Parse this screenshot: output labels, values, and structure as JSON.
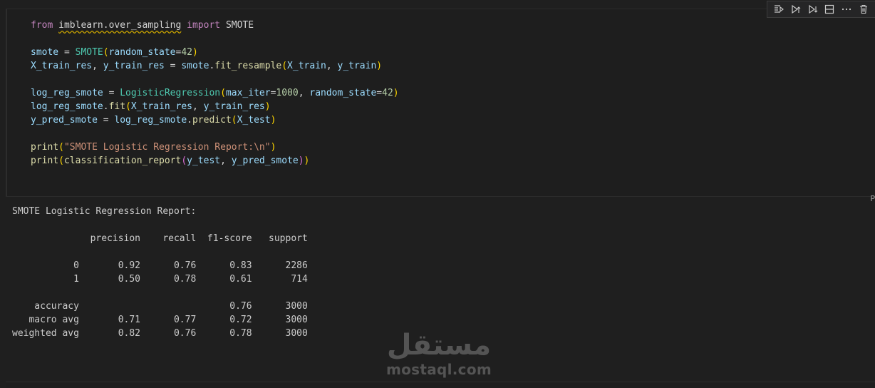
{
  "toolbar": {
    "icons": [
      "run-by-line-icon",
      "execute-above-icon",
      "execute-below-icon",
      "split-cell-icon",
      "more-icon",
      "delete-icon"
    ]
  },
  "cell": {
    "language": "P",
    "code": {
      "l1_from": "from",
      "l1_module": "imblearn.over_sampling",
      "l1_import": "import",
      "l1_name": "SMOTE",
      "l3_var": "smote",
      "l3_eq": " = ",
      "l3_cls": "SMOTE",
      "l3_arg": "random_state",
      "l3_val": "42",
      "l4_v1": "X_train_res",
      "l4_v2": "y_train_res",
      "l4_obj": "smote",
      "l4_fn": "fit_resample",
      "l4_a1": "X_train",
      "l4_a2": "y_train",
      "l6_var": "log_reg_smote",
      "l6_cls": "LogisticRegression",
      "l6_arg1": "max_iter",
      "l6_val1": "1000",
      "l6_arg2": "random_state",
      "l6_val2": "42",
      "l7_obj": "log_reg_smote",
      "l7_fn": "fit",
      "l7_a1": "X_train_res",
      "l7_a2": "y_train_res",
      "l8_var": "y_pred_smote",
      "l8_obj": "log_reg_smote",
      "l8_fn": "predict",
      "l8_a1": "X_test",
      "l10_fn": "print",
      "l10_str": "\"SMOTE Logistic Regression Report:\\n\"",
      "l11_fn": "print",
      "l11_fn2": "classification_report",
      "l11_a1": "y_test",
      "l11_a2": "y_pred_smote"
    }
  },
  "output": {
    "text": "SMOTE Logistic Regression Report:\n\n              precision    recall  f1-score   support\n\n           0       0.92      0.76      0.83      2286\n           1       0.50      0.78      0.61       714\n\n    accuracy                           0.76      3000\n   macro avg       0.71      0.77      0.72      3000\nweighted avg       0.82      0.76      0.78      3000"
  },
  "watermark": {
    "arabic": "مستقل",
    "latin": "mostaql.com"
  }
}
